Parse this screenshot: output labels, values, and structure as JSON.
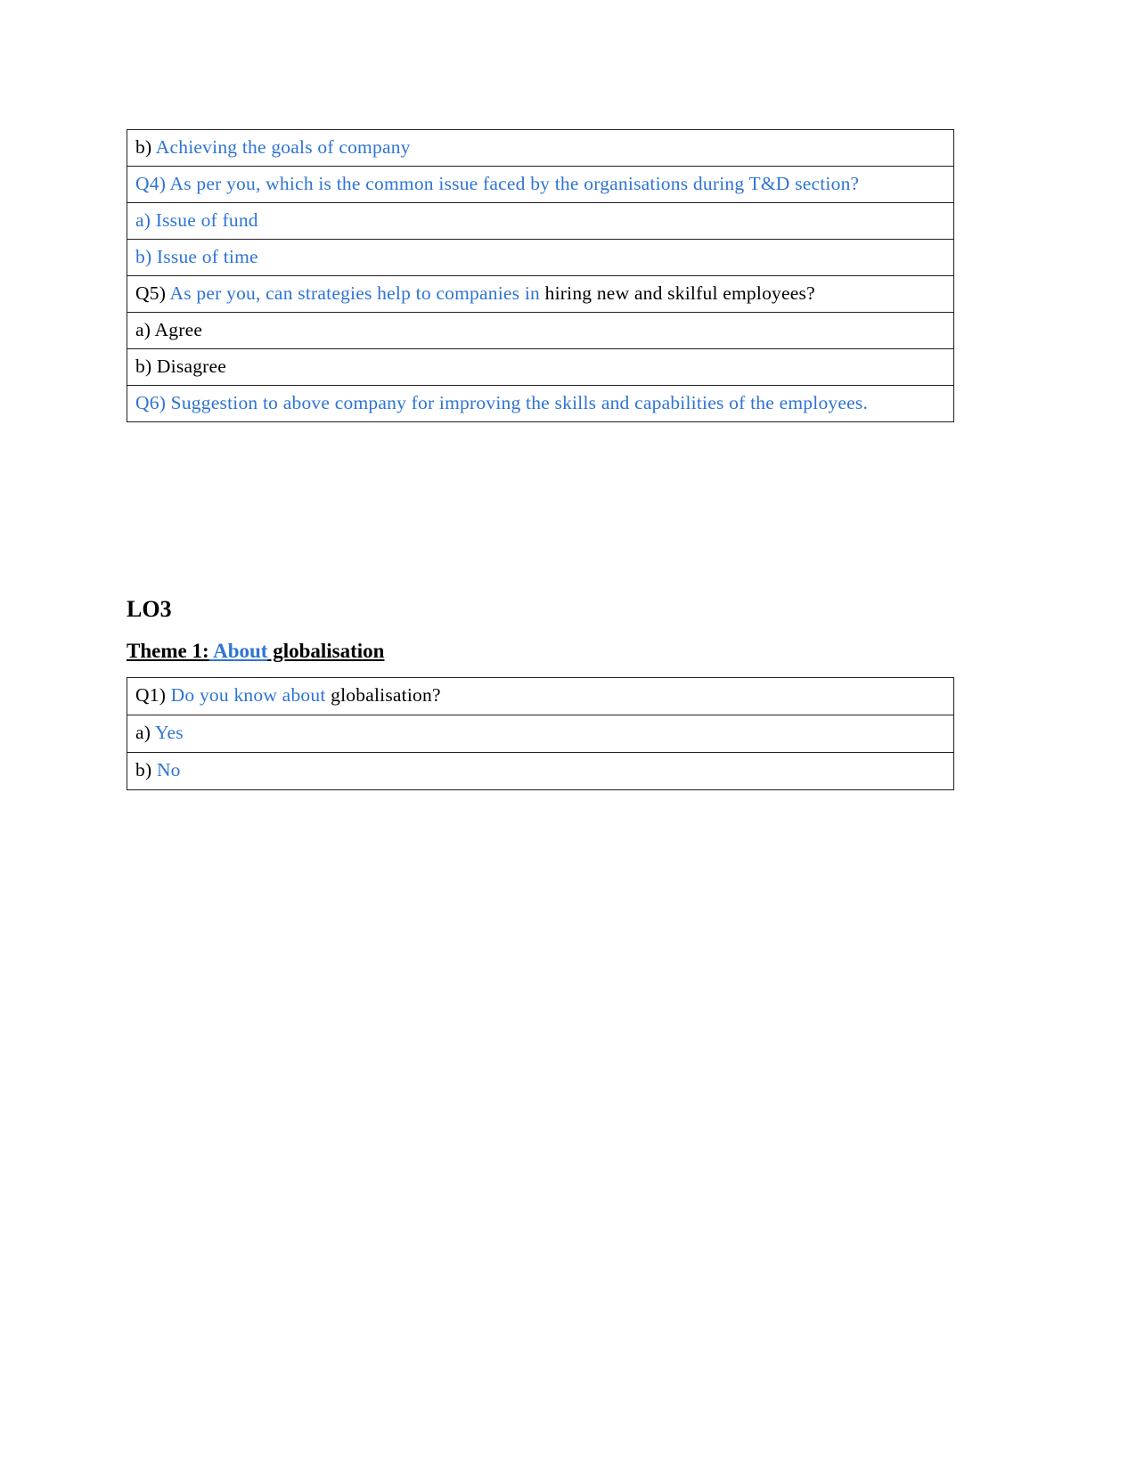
{
  "document": {
    "page_background": "#ffffff",
    "accent_blue": "#2e74d4",
    "body_color": "#000000"
  },
  "table_one": {
    "name": "training-and-development-questionnaire-table",
    "rows": [
      {
        "id": "row-b-achieving-goals",
        "segments": [
          {
            "text": "b) ",
            "color": "black"
          },
          {
            "text": "Achieving the goals of company",
            "color": "blue"
          }
        ]
      },
      {
        "id": "row-q4",
        "segments": [
          {
            "text": "Q4) As per you, which is the common issue faced by the organisations during T&D section?",
            "color": "blue"
          }
        ]
      },
      {
        "id": "row-q4-option-a",
        "segments": [
          {
            "text": "a) Issue of fund",
            "color": "blue"
          }
        ]
      },
      {
        "id": "row-q4-option-b",
        "segments": [
          {
            "text": "b) Issue of time",
            "color": "blue"
          }
        ]
      },
      {
        "id": "row-q5",
        "segments": [
          {
            "text": "Q5) ",
            "color": "black"
          },
          {
            "text": "As per  you, can strategies help to companies in ",
            "color": "blue"
          },
          {
            "text": "hiring new and skilful employees?",
            "color": "black"
          }
        ]
      },
      {
        "id": "row-q5-option-a",
        "segments": [
          {
            "text": "a) Agree",
            "color": "black"
          }
        ]
      },
      {
        "id": "row-q5-option-b",
        "segments": [
          {
            "text": "b) Disagree",
            "color": "black"
          }
        ]
      },
      {
        "id": "row-q6",
        "segments": [
          {
            "text": "Q6) Suggestion to above company for improving the skills and capabilities of the employees.",
            "color": "blue"
          }
        ]
      }
    ]
  },
  "lo3": {
    "heading": "LO3",
    "theme": {
      "prefix": "Theme 1:",
      "highlight": " About",
      "suffix": " globalisation"
    }
  },
  "table_two": {
    "name": "globalisation-questionnaire-table",
    "rows": [
      {
        "id": "row-q1",
        "segments": [
          {
            "text": "Q1) ",
            "color": "black"
          },
          {
            "text": "Do you know about",
            "color": "blue"
          },
          {
            "text": "  globalisation?",
            "color": "black"
          }
        ]
      },
      {
        "id": "row-q1-option-a",
        "segments": [
          {
            "text": "a) ",
            "color": "black"
          },
          {
            "text": "Yes",
            "color": "blue"
          }
        ]
      },
      {
        "id": "row-q1-option-b",
        "segments": [
          {
            "text": "b) ",
            "color": "black"
          },
          {
            "text": "No",
            "color": "blue"
          }
        ]
      }
    ]
  }
}
